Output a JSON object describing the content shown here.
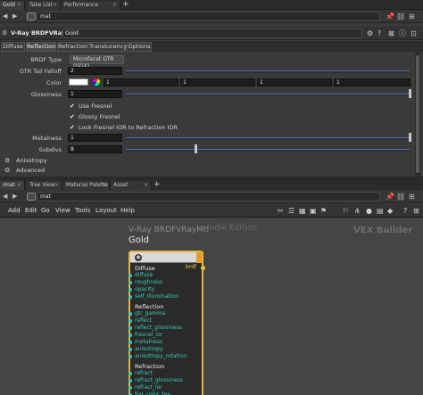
{
  "top_tabs": [
    {
      "label": "Gold",
      "active": true
    },
    {
      "label": "Take List",
      "active": false
    },
    {
      "label": "Performance Monitor",
      "active": false
    }
  ],
  "top_path": {
    "value": "mat"
  },
  "node": {
    "type_label": "V-Ray BRDFVRayMtl",
    "name": "Gold"
  },
  "param_tabs": [
    "Diffuse",
    "Reflection",
    "Refraction",
    "Translucency",
    "Options"
  ],
  "active_param_tab": "Reflection",
  "params": {
    "brdf_type": {
      "label": "BRDF Type",
      "value": "Microfacet GTR (GGX)"
    },
    "gtr_tail": {
      "label": "GTR Tail Falloff",
      "value": "2"
    },
    "color": {
      "label": "Color",
      "values": [
        "1",
        "1",
        "1",
        "1"
      ],
      "swatch": "#ffffff"
    },
    "glossiness": {
      "label": "Glossiness",
      "value": "1"
    },
    "use_fresnel": {
      "label": "Use Fresnel",
      "checked": true
    },
    "glossy_fresnel": {
      "label": "Glossy Fresnel",
      "checked": true
    },
    "lock_fresnel": {
      "label": "Lock Fresnel IOR to Refraction IOR",
      "checked": true
    },
    "metalness": {
      "label": "Metalness",
      "value": "1"
    },
    "subdivs": {
      "label": "Subdivs",
      "value": "8",
      "slider_fraction": 0.25
    },
    "anisotropy": "Anisotropy",
    "advanced": "Advanced"
  },
  "bottom_tabs": [
    {
      "label": "/mat",
      "active": true
    },
    {
      "label": "Tree View",
      "active": false
    },
    {
      "label": "Material Palette",
      "active": false
    },
    {
      "label": "Asset Browser",
      "active": false
    }
  ],
  "bottom_path": {
    "value": "mat"
  },
  "menu": [
    "Add",
    "Edit",
    "Go",
    "View",
    "Tools",
    "Layout",
    "Help"
  ],
  "graph": {
    "watermark_type": "V-Ray BRDFVRayMtl",
    "watermark_name": "Gold",
    "edition": "Indie Edition",
    "context": "VEX Builder",
    "output": "brdf",
    "sections": [
      {
        "title": "Diffuse",
        "inputs": [
          "diffuse",
          "roughness",
          "opacity",
          "self_illumination"
        ]
      },
      {
        "title": "Reflection",
        "inputs": [
          "gtr_gamma",
          "reflect",
          "reflect_glossiness",
          "fresnel_ior",
          "metalness",
          "anisotropy",
          "anisotropy_rotation"
        ]
      },
      {
        "title": "Refraction",
        "inputs": [
          "refract",
          "refract_glossiness",
          "refract_ior",
          "fog_color_tex"
        ]
      }
    ]
  },
  "colors": {
    "node_border": "#e3b53e",
    "input_port": "#39c9b5",
    "output_port": "#f0c44a",
    "slider_accent": "#4b6ea8"
  }
}
